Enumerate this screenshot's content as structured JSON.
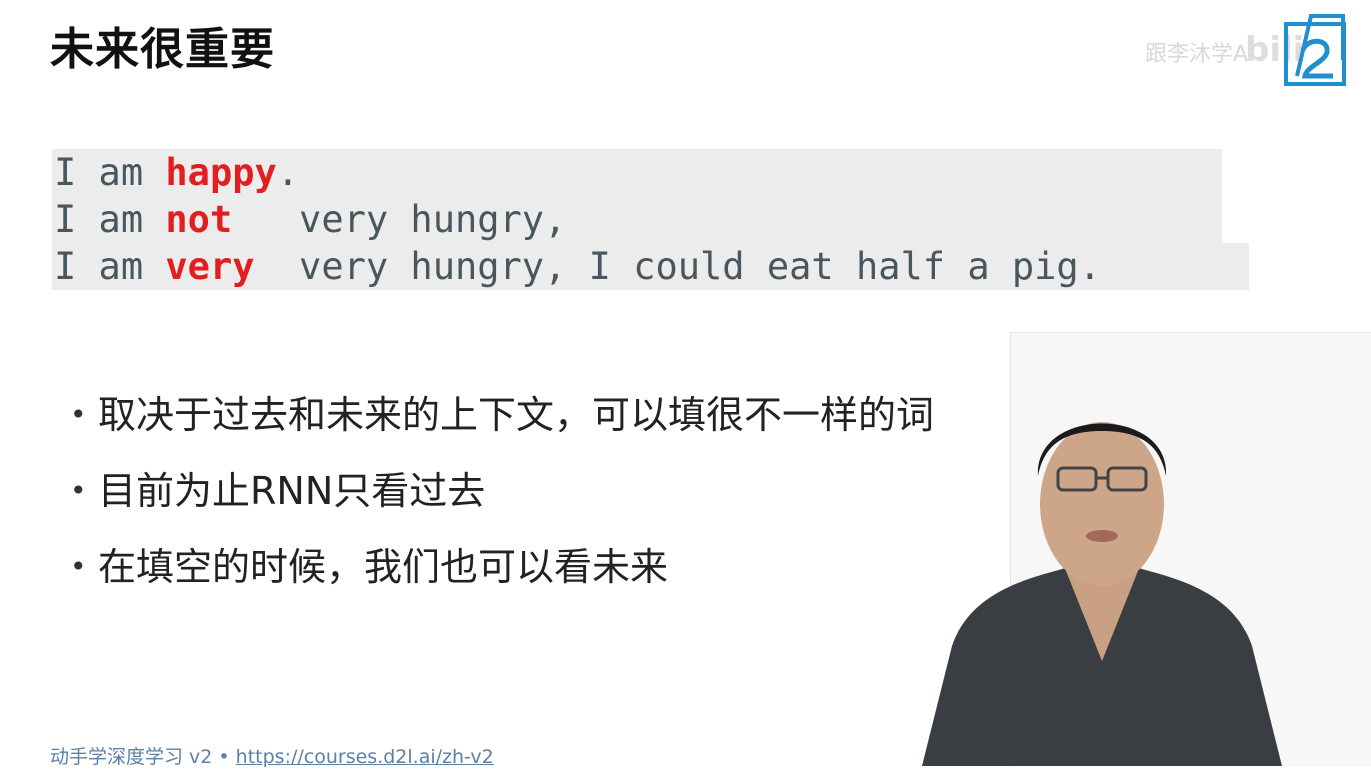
{
  "slide": {
    "title": "未来很重要",
    "code_lines": [
      {
        "prefix": "I am ",
        "keyword": "happy",
        "suffix": "."
      },
      {
        "prefix": "I am ",
        "keyword": "not",
        "suffix": "   very hungry,"
      },
      {
        "prefix": "I am ",
        "keyword": "very",
        "suffix": "  very hungry, I could eat half a pig."
      }
    ],
    "bullets": [
      "取决于过去和未来的上下文，可以填很不一样的词",
      "目前为止RNN只看过去",
      "在填空的时候，我们也可以看未来"
    ],
    "bullet_glyph": "•"
  },
  "brand": {
    "watermark_text": "跟李沐学AI",
    "platform_mark": "bili",
    "logo_icon": "d2l-logo-icon",
    "logo_color": "#1f8fcf"
  },
  "footer": {
    "book_title": "动手学深度学习 v2 • ",
    "link_text": "https://courses.d2l.ai/zh-v2"
  },
  "colors": {
    "keyword": "#e02020",
    "code_text": "#48565e",
    "code_background": "#ececec",
    "footer": "#5b7fa6"
  }
}
